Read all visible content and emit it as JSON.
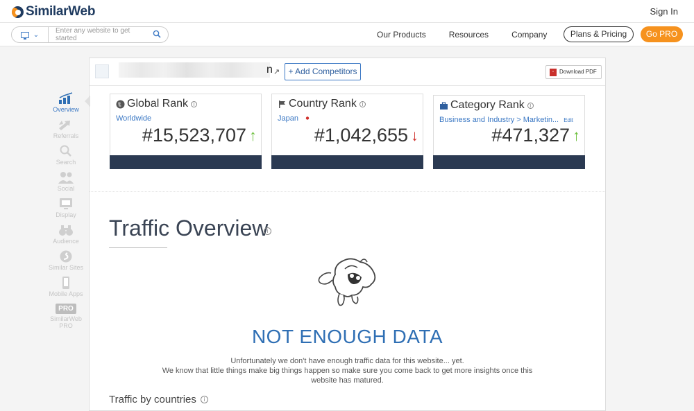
{
  "brand": {
    "name": "SimilarWeb"
  },
  "header": {
    "sign_in": "Sign In"
  },
  "search": {
    "placeholder": "Enter any website to get started"
  },
  "nav": {
    "products": "Our Products",
    "resources": "Resources",
    "company": "Company",
    "plans": "Plans & Pricing",
    "gopro": "Go PRO"
  },
  "colors": {
    "accent": "#3b78c4",
    "orange": "#f6921e",
    "navy": "#2b3a52",
    "up": "#6cbf3b",
    "down": "#d0312d"
  },
  "sidebar": {
    "items": [
      {
        "label": "Overview",
        "icon": "bar-chart-icon"
      },
      {
        "label": "Referrals",
        "icon": "arrows-icon"
      },
      {
        "label": "Search",
        "icon": "magnifier-icon"
      },
      {
        "label": "Social",
        "icon": "people-icon"
      },
      {
        "label": "Display",
        "icon": "display-icon"
      },
      {
        "label": "Audience",
        "icon": "binoculars-icon"
      },
      {
        "label": "Similar Sites",
        "icon": "similar-icon"
      },
      {
        "label": "Mobile Apps",
        "icon": "phone-icon"
      },
      {
        "label": "SimilarWeb PRO",
        "tag": "PRO"
      }
    ]
  },
  "site": {
    "name_suffix": "n"
  },
  "actions": {
    "add_competitors": "+ Add Competitors",
    "download_pdf": "Download PDF"
  },
  "ranks": [
    {
      "title": "Global Rank",
      "sub": "Worldwide",
      "value": "#15,523,707",
      "trend": "↑"
    },
    {
      "title": "Country Rank",
      "sub": "Japan",
      "value": "#1,042,655",
      "trend": "↓"
    },
    {
      "title": "Category Rank",
      "sub": "Business and Industry > Marketin...",
      "edit": "Edit",
      "value": "#471,327",
      "trend": "↑"
    }
  ],
  "traffic": {
    "title": "Traffic Overview",
    "empty_title": "NOT ENOUGH DATA",
    "empty_line1": "Unfortunately we don't have enough traffic data for this website... yet.",
    "empty_line2": "We know that little things make big things happen so make sure you come back to get more insights once this",
    "empty_line3": "website has matured.",
    "by_countries": "Traffic by countries"
  }
}
